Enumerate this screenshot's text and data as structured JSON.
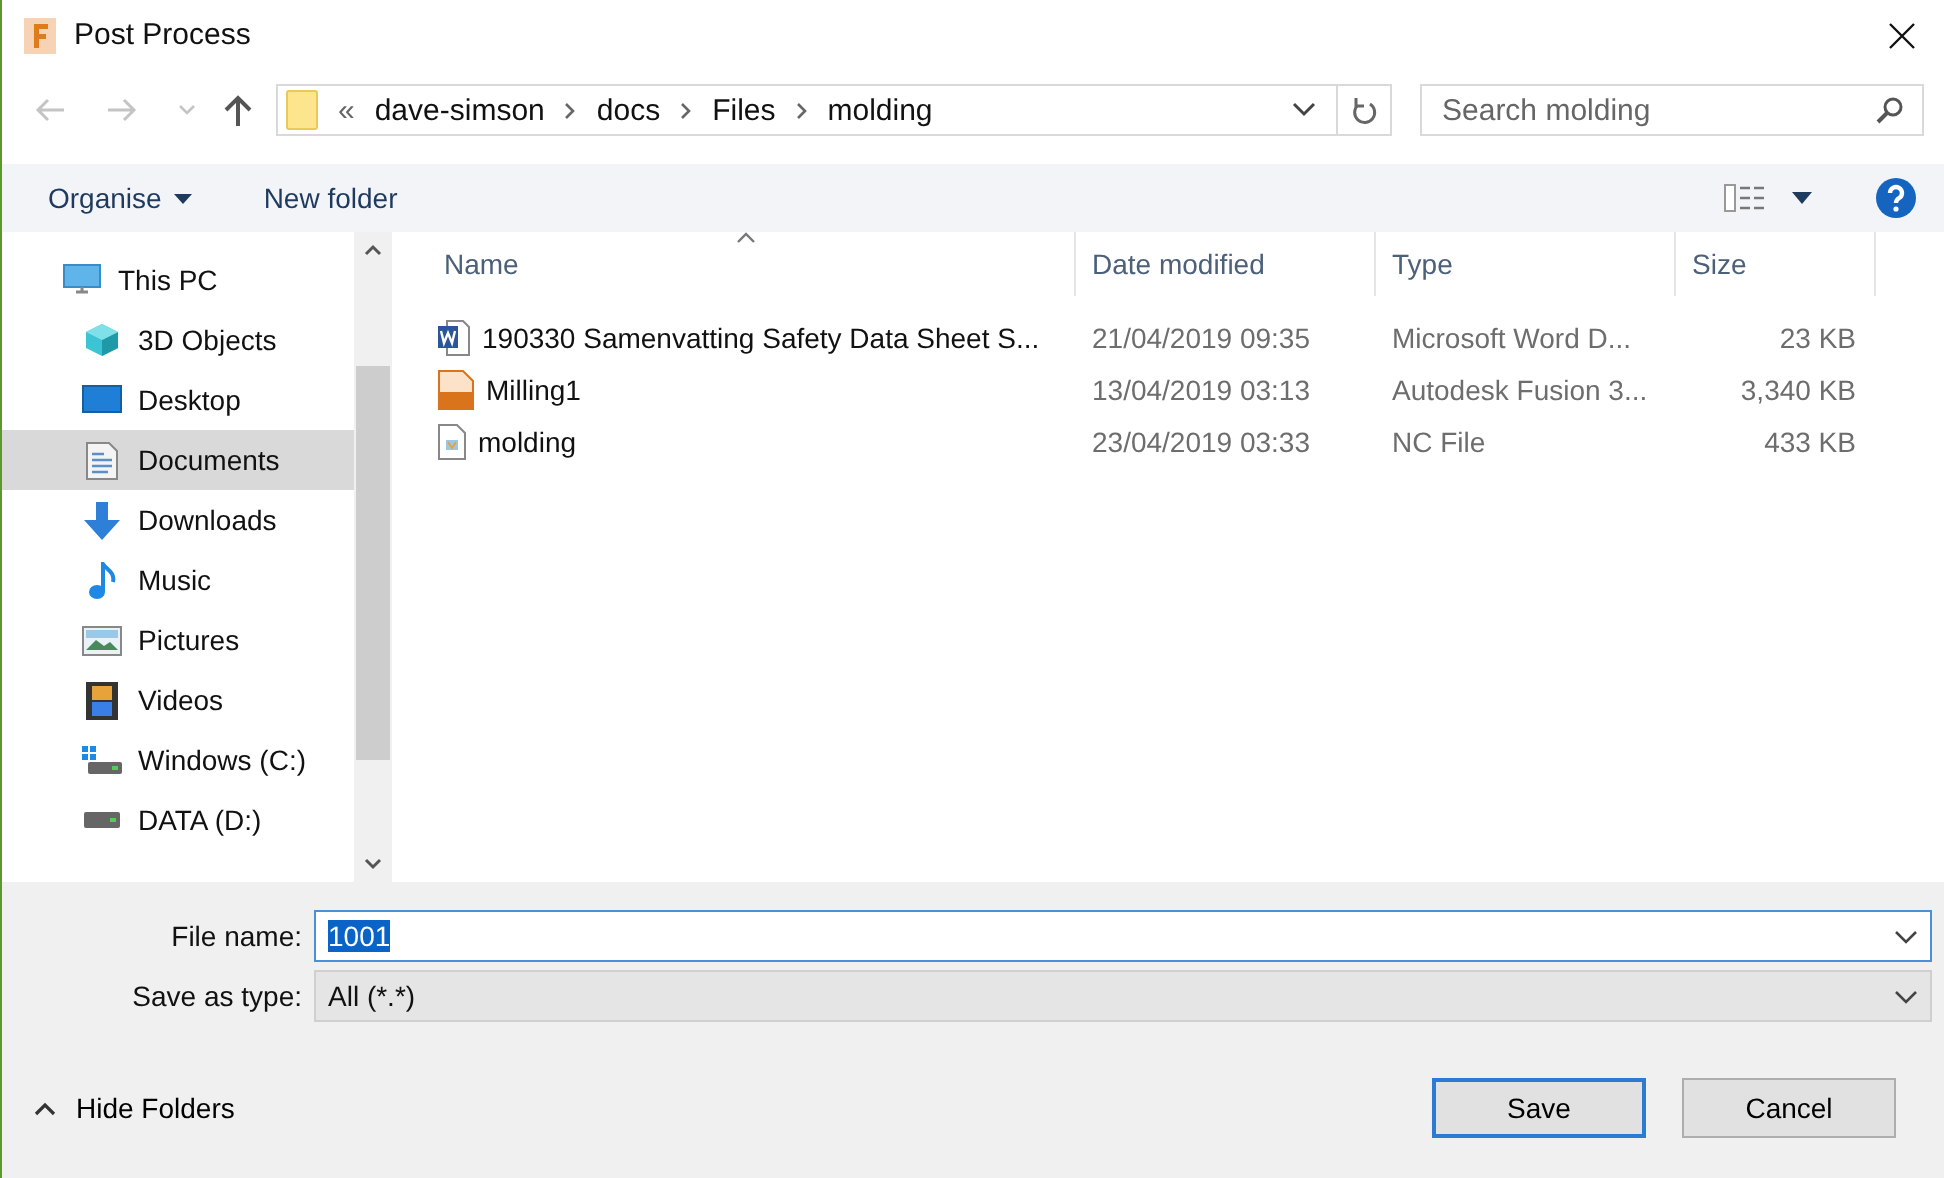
{
  "window": {
    "title": "Post Process"
  },
  "address_bar": {
    "overflow": "«",
    "crumbs": [
      "dave-simson",
      "docs",
      "Files",
      "molding"
    ]
  },
  "search": {
    "placeholder": "Search molding"
  },
  "toolbar": {
    "organise": "Organise",
    "new_folder": "New folder"
  },
  "nav_pane": {
    "items": [
      {
        "label": "This PC",
        "kind": "pc",
        "selected": false,
        "children": [
          {
            "label": "3D Objects",
            "kind": "cube",
            "selected": false
          },
          {
            "label": "Desktop",
            "kind": "desktop",
            "selected": false
          },
          {
            "label": "Documents",
            "kind": "documents",
            "selected": true
          },
          {
            "label": "Downloads",
            "kind": "downloads",
            "selected": false
          },
          {
            "label": "Music",
            "kind": "music",
            "selected": false
          },
          {
            "label": "Pictures",
            "kind": "pictures",
            "selected": false
          },
          {
            "label": "Videos",
            "kind": "videos",
            "selected": false
          },
          {
            "label": "Windows (C:)",
            "kind": "windrive",
            "selected": false
          },
          {
            "label": "DATA (D:)",
            "kind": "drive",
            "selected": false
          }
        ]
      }
    ]
  },
  "file_list": {
    "columns": [
      {
        "label": "Name",
        "sorted": true
      },
      {
        "label": "Date modified",
        "sorted": false
      },
      {
        "label": "Type",
        "sorted": false
      },
      {
        "label": "Size",
        "sorted": false
      }
    ],
    "rows": [
      {
        "kind": "word",
        "name": "190330 Samenvatting Safety Data Sheet S...",
        "date": "21/04/2019 09:35",
        "type": "Microsoft Word D...",
        "size": "23 KB"
      },
      {
        "kind": "f3d",
        "name": "Milling1",
        "date": "13/04/2019 03:13",
        "type": "Autodesk Fusion 3...",
        "size": "3,340 KB"
      },
      {
        "kind": "nc",
        "name": "molding",
        "date": "23/04/2019 03:33",
        "type": "NC File",
        "size": "433 KB"
      }
    ]
  },
  "file_name": {
    "label": "File name:",
    "value": "1001",
    "selected": true
  },
  "save_as_type": {
    "label": "Save as type:",
    "value": "All (*.*)"
  },
  "hide_folders": "Hide Folders",
  "buttons": [
    {
      "label": "Save",
      "default": true
    },
    {
      "label": "Cancel",
      "default": false
    }
  ]
}
